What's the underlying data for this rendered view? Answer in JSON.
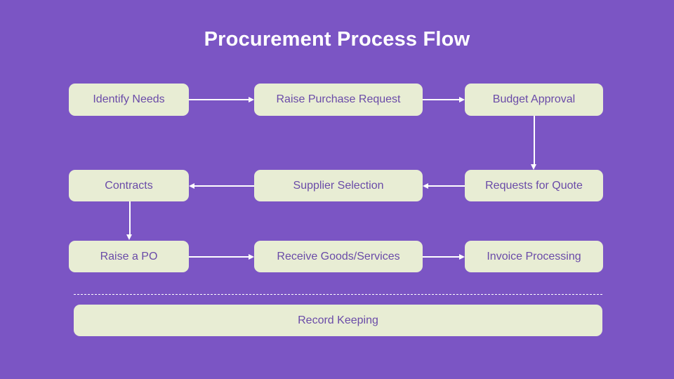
{
  "diagram": {
    "title": "Procurement Process Flow",
    "background_color": "#7b55c4",
    "node_fill_color": "#e8edd4",
    "node_text_color": "#6a4ba8",
    "connector_color": "#ffffff",
    "title_color": "#ffffff",
    "rows": [
      {
        "direction": "left-to-right",
        "nodes": [
          {
            "label": "Identify Needs"
          },
          {
            "label": "Raise Purchase Request"
          },
          {
            "label": "Budget Approval"
          }
        ]
      },
      {
        "direction": "right-to-left",
        "nodes": [
          {
            "label": "Contracts"
          },
          {
            "label": "Supplier Selection"
          },
          {
            "label": "Requests for Quote"
          }
        ]
      },
      {
        "direction": "left-to-right",
        "nodes": [
          {
            "label": "Raise a PO"
          },
          {
            "label": "Receive Goods/Services"
          },
          {
            "label": "Invoice Processing"
          }
        ]
      }
    ],
    "footer": {
      "label": "Record Keeping",
      "divider_style": "dashed"
    }
  }
}
